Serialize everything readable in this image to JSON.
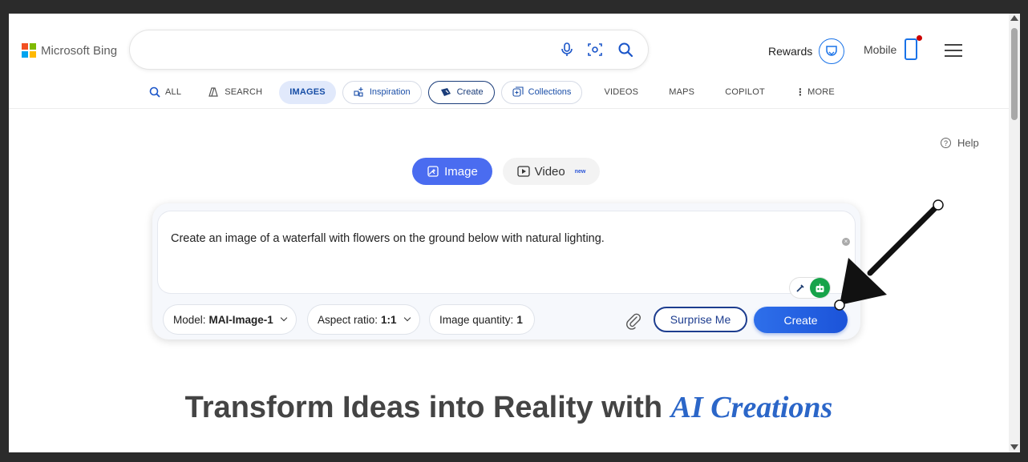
{
  "brand": {
    "name": "Microsoft Bing",
    "logo_colors": [
      "#f25022",
      "#7fba00",
      "#00a4ef",
      "#ffb900"
    ]
  },
  "search": {
    "value": "",
    "placeholder": ""
  },
  "header": {
    "rewards_label": "Rewards",
    "mobile_label": "Mobile"
  },
  "tabs": [
    {
      "label": "ALL",
      "icon": "search-icon"
    },
    {
      "label": "SEARCH",
      "icon": "copilot-search-icon"
    },
    {
      "label": "IMAGES",
      "active": true
    },
    {
      "label": "Inspiration",
      "icon": "sparkle-grid-icon"
    },
    {
      "label": "Create",
      "icon": "create-image-icon"
    },
    {
      "label": "Collections",
      "icon": "collections-icon"
    },
    {
      "label": "VIDEOS"
    },
    {
      "label": "MAPS"
    },
    {
      "label": "COPILOT"
    },
    {
      "label": "MORE",
      "icon": "more-vertical-icon"
    }
  ],
  "help_label": "Help",
  "modes": {
    "image_label": "Image",
    "video_label": "Video",
    "video_badge": "new"
  },
  "prompt": {
    "text": "Create an image of a waterfall with flowers on the ground below with natural lighting."
  },
  "options": {
    "model_label": "Model:",
    "model_value": "MAI-Image-1",
    "aspect_label": "Aspect ratio:",
    "aspect_value": "1:1",
    "quantity_label": "Image quantity:",
    "quantity_value": "1"
  },
  "actions": {
    "surprise_label": "Surprise Me",
    "create_label": "Create"
  },
  "headline": {
    "text": "Transform Ideas into Reality with ",
    "emphasis": "AI Creations"
  },
  "colors": {
    "accent": "#4a6cf0",
    "create_button": "#1b53d9",
    "active_tab_bg": "#e1e9fb",
    "headline_emphasis": "#2b66c8"
  }
}
